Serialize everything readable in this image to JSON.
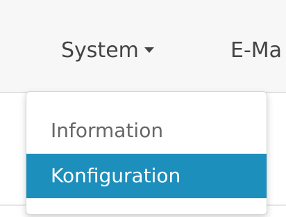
{
  "navbar": {
    "items": [
      {
        "label": "System"
      },
      {
        "label": "E-Ma"
      }
    ]
  },
  "dropdown": {
    "items": [
      {
        "label": "Information"
      },
      {
        "label": "Konfiguration"
      }
    ]
  },
  "colors": {
    "navbar_bg": "#f7f7f7",
    "active_item_bg": "#1d8fbd",
    "active_item_text": "#ffffff",
    "menu_text": "#666666"
  }
}
